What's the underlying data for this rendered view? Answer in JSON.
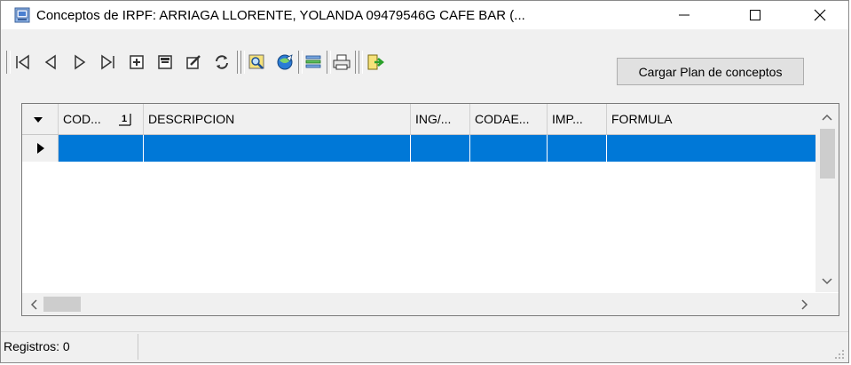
{
  "window": {
    "title": "Conceptos de IRPF: ARRIAGA LLORENTE, YOLANDA 09479546G CAFE BAR (...",
    "controls": {
      "minimize": "—",
      "maximize": "☐",
      "close": "✕"
    }
  },
  "toolbar": {
    "nav_icons": [
      "first-record-icon",
      "prior-record-icon",
      "next-record-icon",
      "last-record-icon",
      "insert-record-icon",
      "delete-record-icon",
      "edit-record-icon",
      "refresh-icon"
    ],
    "tool_icons": [
      "search-icon",
      "browse-icon",
      "filter-icon",
      "print-icon",
      "exit-icon"
    ],
    "cargar_label": "Cargar Plan de conceptos"
  },
  "grid": {
    "columns": [
      {
        "label": "COD...",
        "sort_marker": "1"
      },
      {
        "label": "DESCRIPCION"
      },
      {
        "label": "ING/..."
      },
      {
        "label": "CODAE..."
      },
      {
        "label": "IMP..."
      },
      {
        "label": "FORMULA"
      }
    ],
    "rows": [
      [
        "",
        "",
        "",
        "",
        "",
        ""
      ]
    ],
    "selected_row_color": "#0078d7"
  },
  "status": {
    "records": "Registros: 0"
  }
}
